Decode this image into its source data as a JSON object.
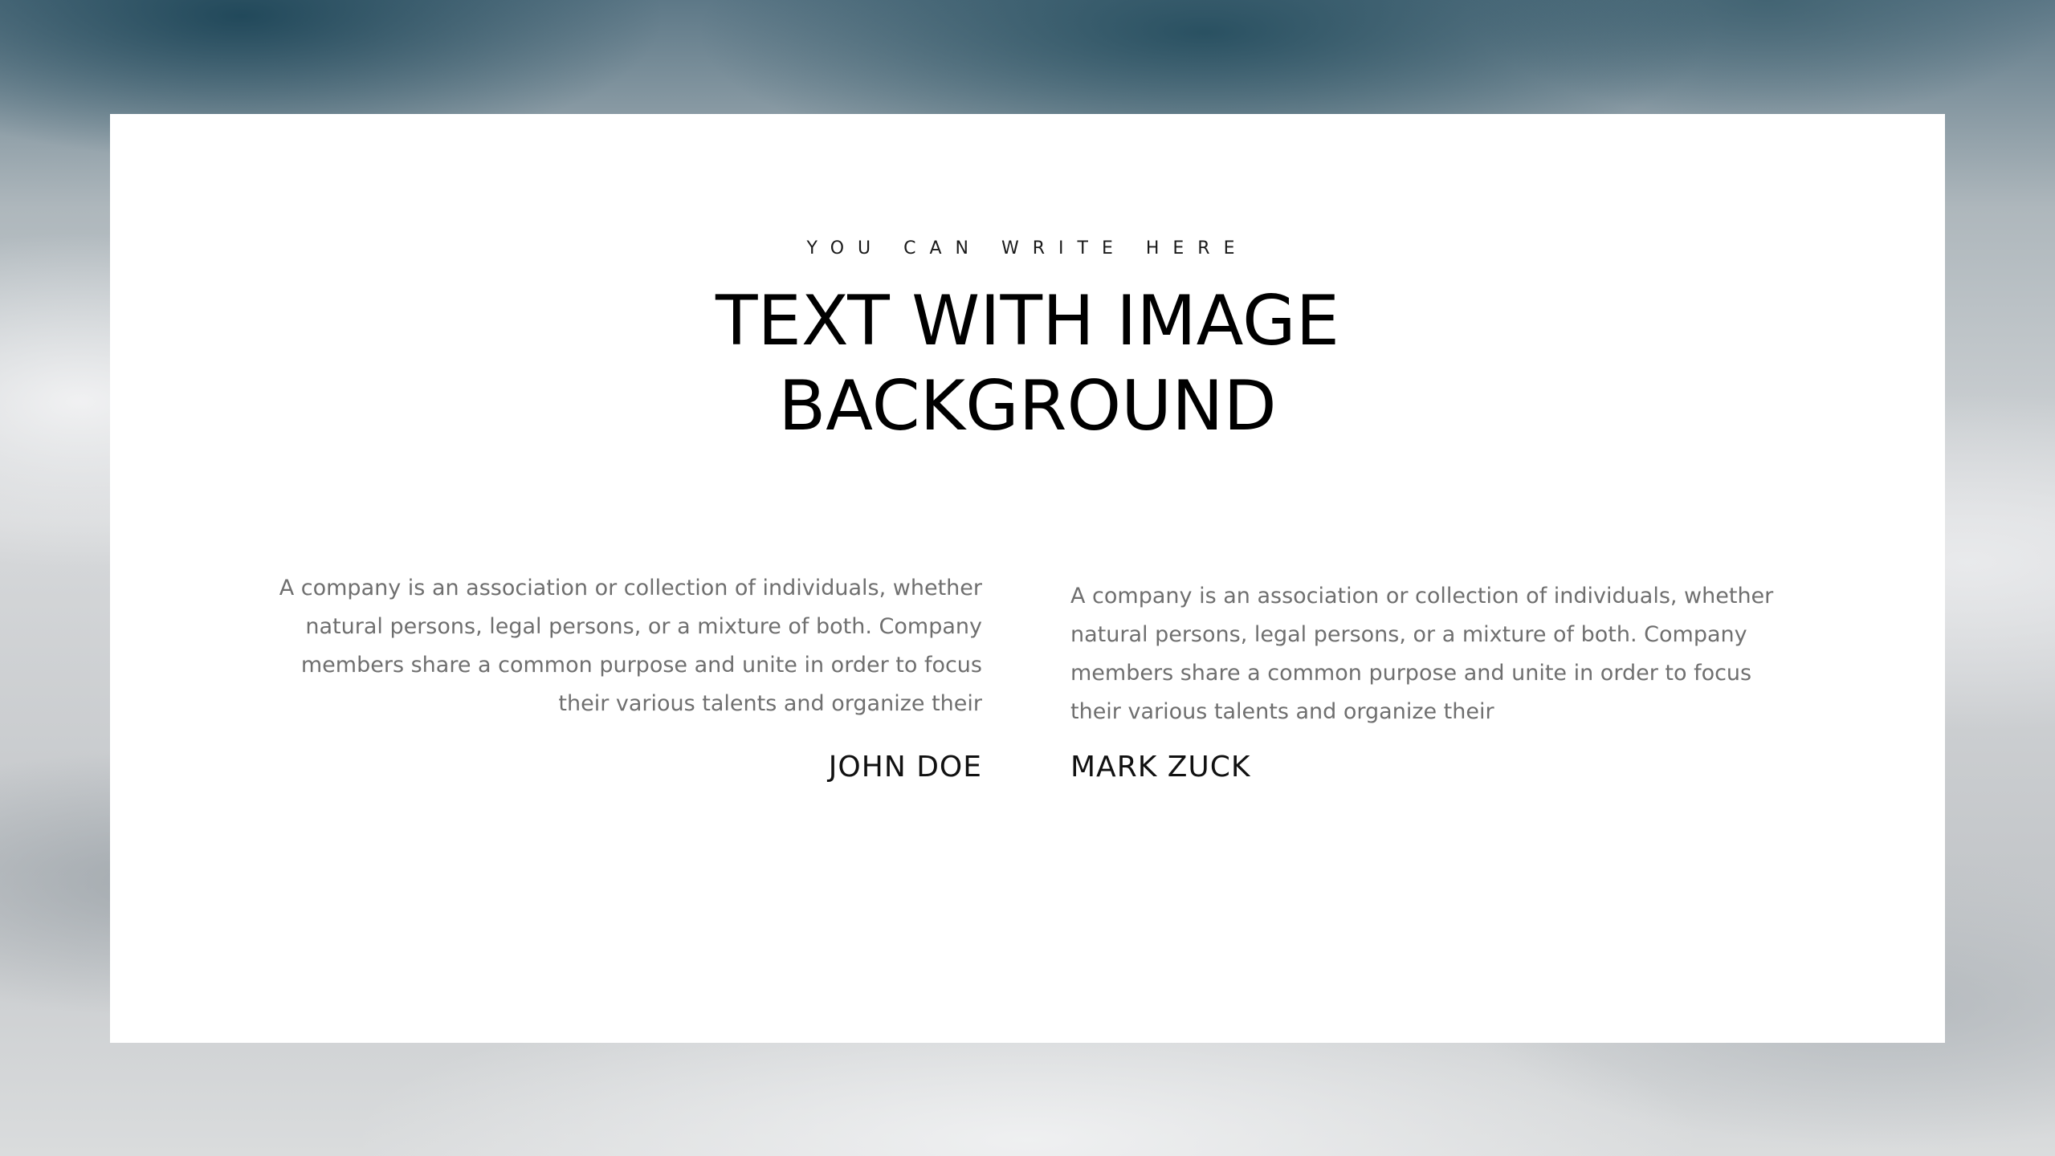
{
  "slide": {
    "eyebrow": "YOU CAN WRITE HERE",
    "title_line1": "TEXT WITH IMAGE",
    "title_line2": "BACKGROUND"
  },
  "columns": [
    {
      "lines": [
        "A company is an association or collection of individuals, whether",
        "natural persons, legal persons, or a mixture of both. Company",
        "members share a common purpose and unite in order to focus",
        "their various talents and organize their"
      ],
      "name": "JOHN DOE"
    },
    {
      "lines": [
        "A company is an association or collection of individuals, whether",
        "natural persons, legal persons, or a mixture of both. Company",
        "members share a common purpose and unite in order to focus",
        "their various talents and organize their"
      ],
      "name": "MARK ZUCK"
    }
  ],
  "colors": {
    "card": "#ffffff",
    "title": "#000000",
    "body_text": "#6f6f6f"
  }
}
